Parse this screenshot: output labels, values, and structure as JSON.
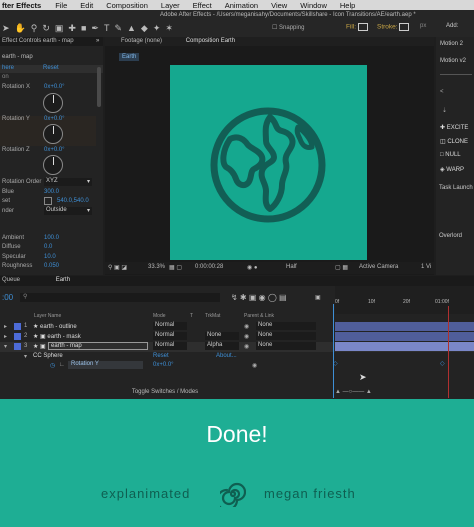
{
  "menubar": {
    "app": "fter Effects",
    "items": [
      "File",
      "Edit",
      "Composition",
      "Layer",
      "Effect",
      "Animation",
      "View",
      "Window",
      "Help"
    ]
  },
  "toolbar": {
    "title": "Adobe After Effects - /Users/meganisahy/Documents/Skillshare - Icon Transitions/AE/earth.aep *",
    "snapping": "Snapping",
    "fill": "Fill:",
    "stroke": "Stroke:",
    "unit": "px",
    "add": "Add:"
  },
  "effects": {
    "header": "Effect Controls earth - map",
    "sub": "earth - map",
    "effect_name": "here",
    "reset": "Reset",
    "rotx_label": "Rotation X",
    "rotx_val": "0x+0.0°",
    "roty_label": "Rotation Y",
    "roty_val": "0x+0.0°",
    "rotz_label": "Rotation Z",
    "rotz_val": "0x+0.0°",
    "order_label": "Rotation Order",
    "order_val": "XYZ",
    "blue_label": "Blue",
    "blue_val": "300.0",
    "offset_label": "set",
    "offset_val": "540.0,540.0",
    "render_label": "nder",
    "render_val": "Outside",
    "ambient_label": "Ambient",
    "ambient_val": "100.0",
    "diffuse_label": "Diffuse",
    "diffuse_val": "0.0",
    "specular_label": "Specular",
    "specular_val": "10.0",
    "rough_label": "Roughness",
    "rough_val": "0.050"
  },
  "footage_tab": "Footage (none)",
  "comp_tab": "Composition Earth",
  "comp_name": "Earth",
  "viewer": {
    "zoom": "33.3%",
    "timecode": "0:00:00:28",
    "quality": "Half",
    "camera": "Active Camera",
    "view": "1 Vi"
  },
  "rightpanel": {
    "motion": "Motion 2",
    "motion2": "Motion v2",
    "excite": "EXCITE",
    "clone": "CLONE",
    "null": "NULL",
    "warp": "WARP",
    "task": "Task Launch",
    "overlord": "Overlord"
  },
  "timeline": {
    "queue": "Queue",
    "tab": "Earth",
    "time": ":00",
    "col_layer": "Layer Name",
    "col_mode": "Mode",
    "col_t": "T",
    "col_trk": "TrkMat",
    "col_parent": "Parent & Link",
    "ruler": [
      "0f",
      "10f",
      "20f",
      "01:00f"
    ],
    "layers": [
      {
        "num": "1",
        "name": "earth - outline",
        "mode": "Normal",
        "trk": "",
        "parent": "None"
      },
      {
        "num": "2",
        "name": "earth - mask",
        "mode": "Normal",
        "trk": "None",
        "parent": "None"
      },
      {
        "num": "3",
        "name": "earth - map",
        "mode": "Normal",
        "trk": "Alpha",
        "parent": "None"
      }
    ],
    "cc_sphere": "CC Sphere",
    "cc_reset": "Reset",
    "cc_about": "About...",
    "roty": "Rotation Y",
    "roty_val": "0x+0.0°",
    "toggle": "Toggle Switches / Modes"
  },
  "footer": {
    "done": "Done!",
    "brand_left": "explanimated",
    "brand_right": "megan friesth"
  },
  "colors": {
    "accent": "#3e8fd6",
    "teal": "#1eae94",
    "comp": "#15a88f"
  }
}
